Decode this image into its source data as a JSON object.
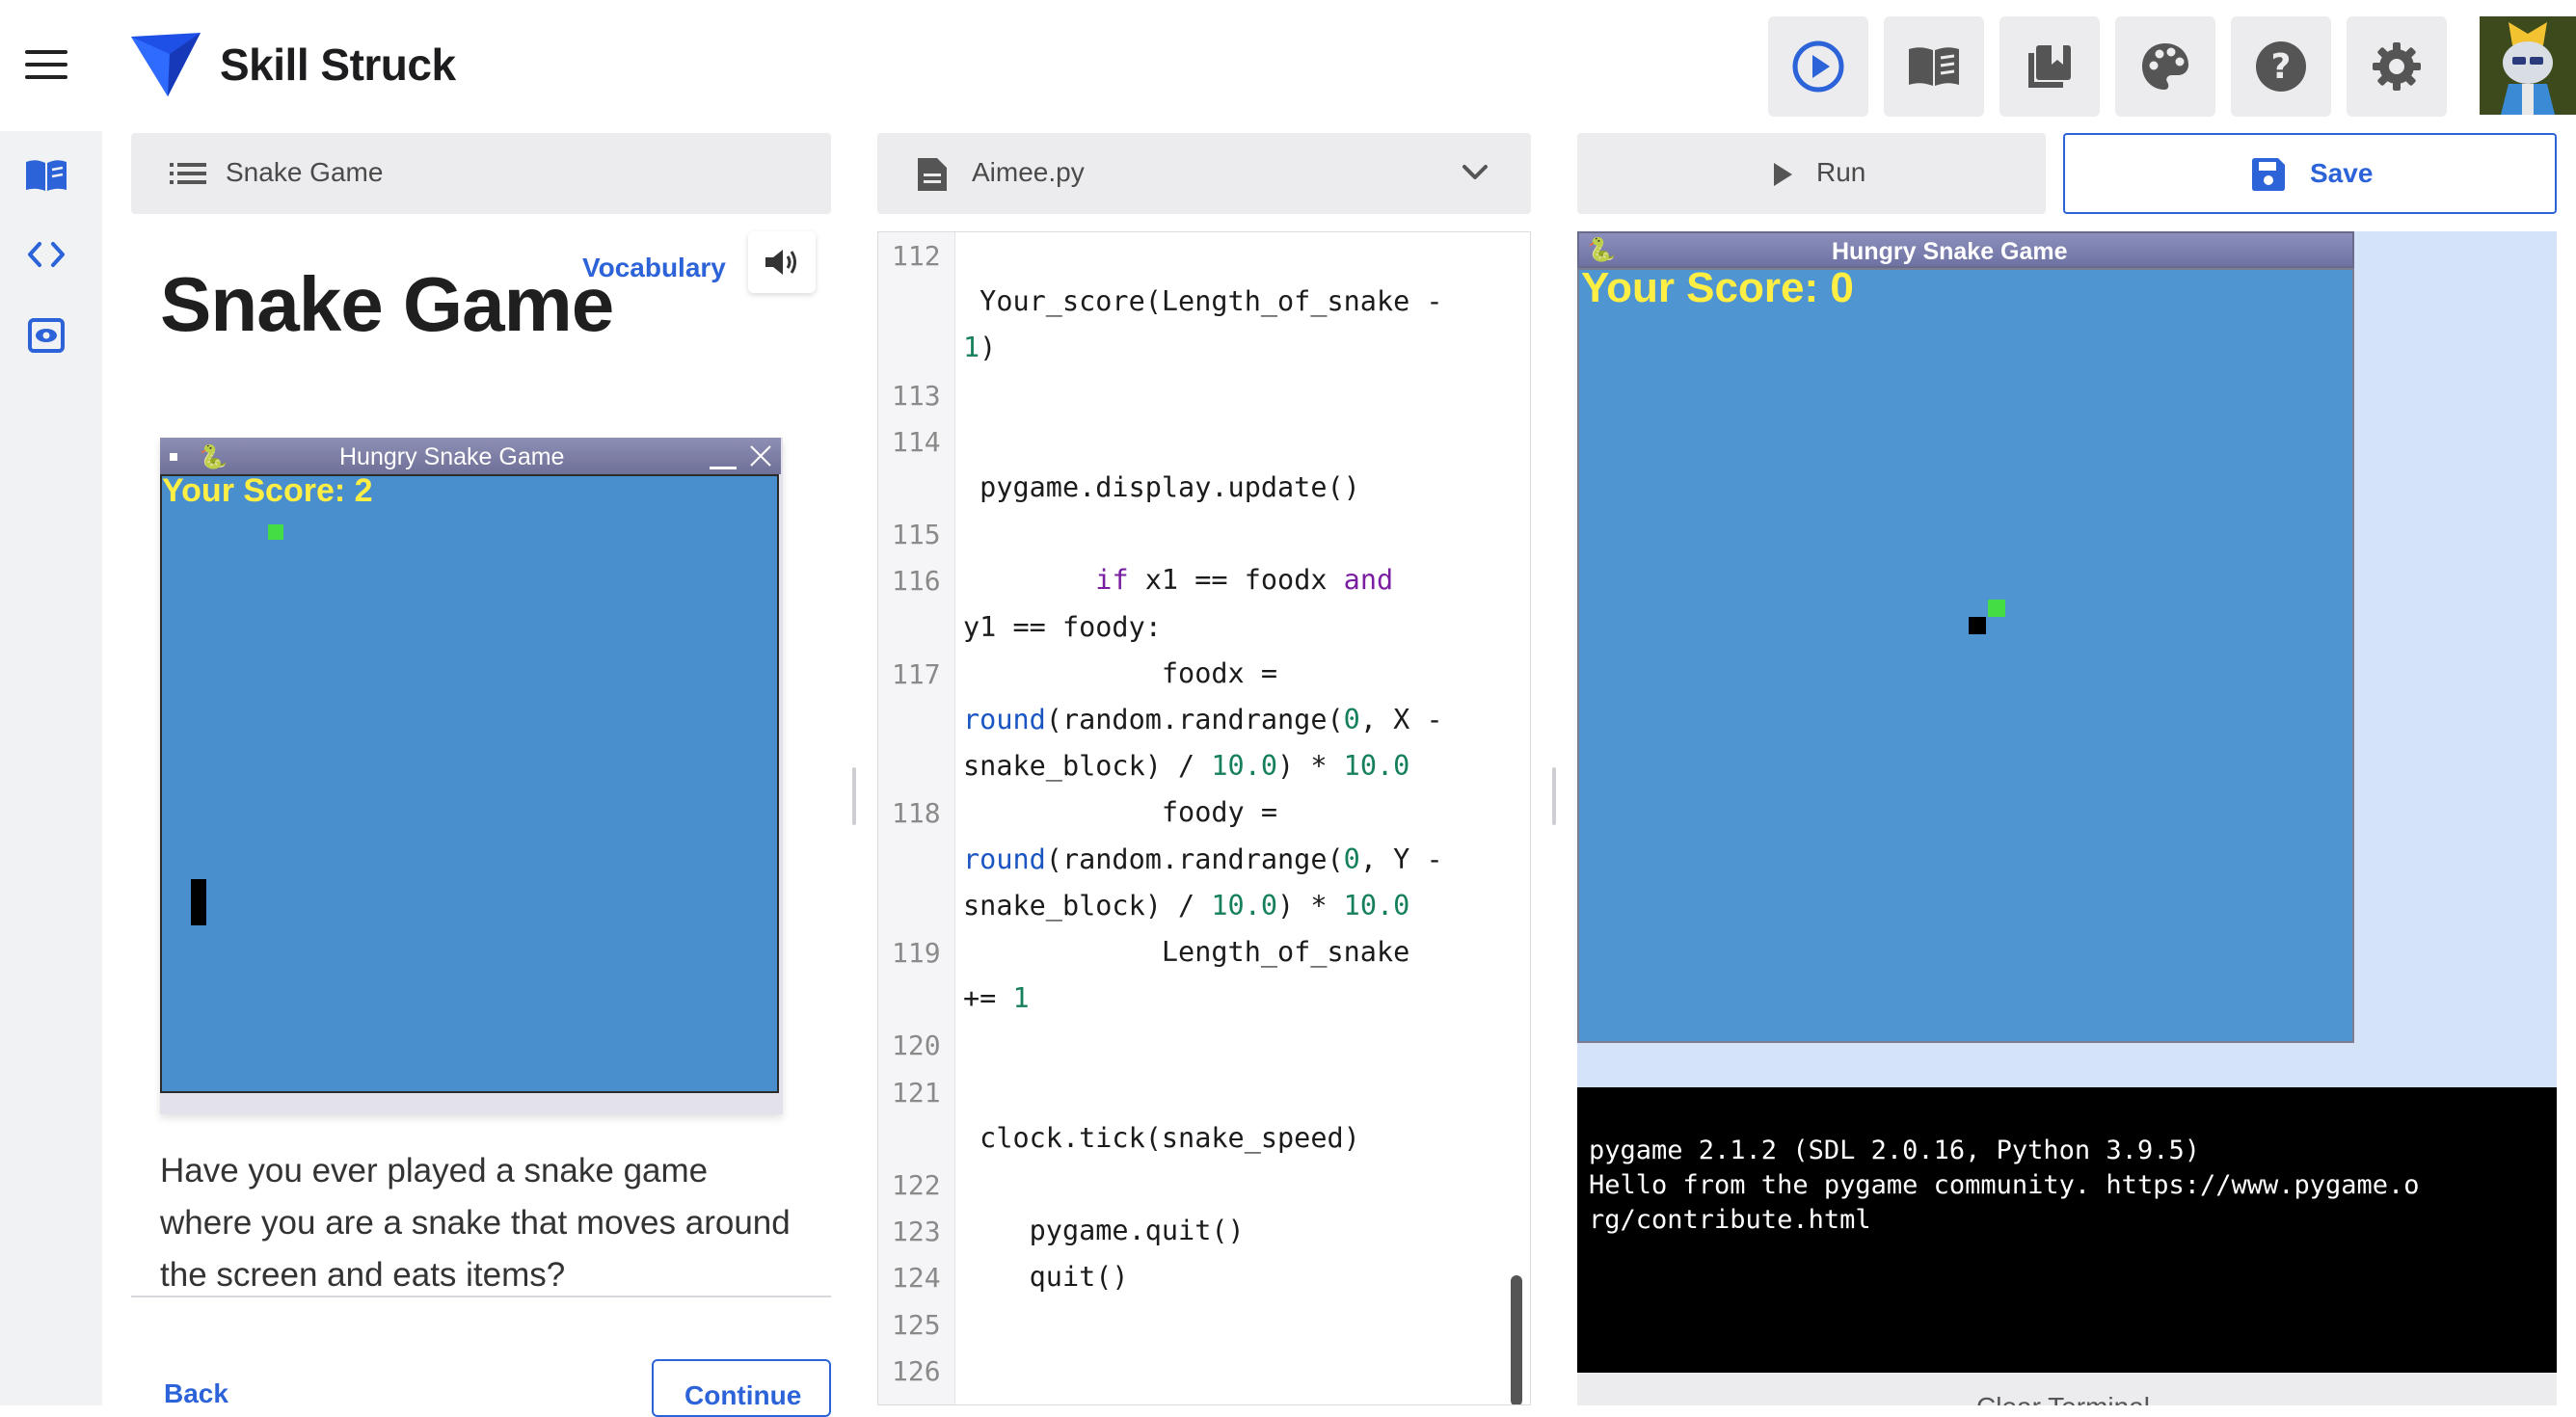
{
  "app": {
    "name": "Skill Struck"
  },
  "toolbar": {
    "icons": [
      "play-circle-icon",
      "book-open-icon",
      "bookmarks-icon",
      "palette-icon",
      "help-icon",
      "settings-icon"
    ]
  },
  "rail": {
    "icons": [
      "lesson-book-icon",
      "code-icon",
      "preview-eye-icon"
    ]
  },
  "lesson": {
    "header_label": "Snake Game",
    "vocabulary_label": "Vocabulary",
    "title": "Snake Game",
    "image": {
      "window_title": "Hungry Snake Game",
      "score_text": "Your Score: 2"
    },
    "paragraph": "Have you ever played a snake game where you are a snake that moves around the screen and eats items?",
    "back_label": "Back",
    "continue_label": "Continue"
  },
  "editor": {
    "file_name": "Aimee.py",
    "lines": [
      {
        "num": "112",
        "code": ""
      },
      {
        "num": "",
        "code": " Your_score(Length_of_snake -"
      },
      {
        "num": "",
        "code": "1)"
      },
      {
        "num": "113",
        "code": ""
      },
      {
        "num": "114",
        "code": ""
      },
      {
        "num": "",
        "code": " pygame.display.update()"
      },
      {
        "num": "115",
        "code": ""
      },
      {
        "num": "116",
        "code": "        if x1 == foodx and"
      },
      {
        "num": "",
        "code": "y1 == foody:"
      },
      {
        "num": "117",
        "code": "            foodx ="
      },
      {
        "num": "",
        "code": "round(random.randrange(0, X -"
      },
      {
        "num": "",
        "code": "snake_block) / 10.0) * 10.0"
      },
      {
        "num": "118",
        "code": "            foody ="
      },
      {
        "num": "",
        "code": "round(random.randrange(0, Y -"
      },
      {
        "num": "",
        "code": "snake_block) / 10.0) * 10.0"
      },
      {
        "num": "119",
        "code": "            Length_of_snake"
      },
      {
        "num": "",
        "code": "+= 1"
      },
      {
        "num": "120",
        "code": ""
      },
      {
        "num": "121",
        "code": ""
      },
      {
        "num": "",
        "code": " clock.tick(snake_speed)"
      },
      {
        "num": "122",
        "code": ""
      },
      {
        "num": "123",
        "code": "    pygame.quit()"
      },
      {
        "num": "124",
        "code": "    quit()"
      },
      {
        "num": "125",
        "code": ""
      },
      {
        "num": "126",
        "code": ""
      }
    ]
  },
  "run": {
    "run_label": "Run",
    "save_label": "Save"
  },
  "output": {
    "window_title": "Hungry Snake Game",
    "score_text": "Your Score: 0"
  },
  "terminal": {
    "lines": [
      "pygame 2.1.2 (SDL 2.0.16, Python 3.9.5)",
      "Hello from the pygame community. https://www.pygame.o",
      "rg/contribute.html"
    ],
    "clear_label": "Clear Terminal"
  },
  "colors": {
    "accent": "#2c63d8",
    "game_field": "#4a8fcd",
    "score_yellow": "#ffee44",
    "snake_food": "#44dd44"
  }
}
